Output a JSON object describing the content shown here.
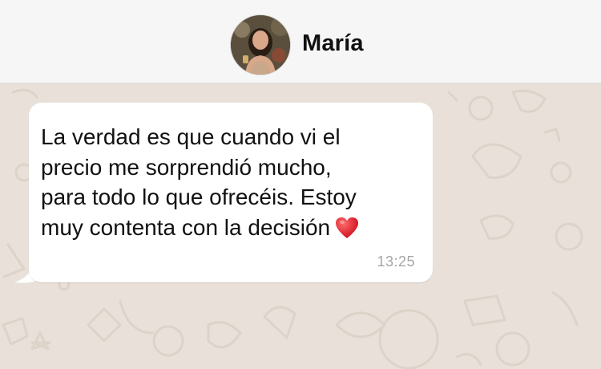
{
  "header": {
    "contact_name": "María",
    "avatar": "contact-photo"
  },
  "chat": {
    "wallpaper": "doodle-pattern",
    "messages": [
      {
        "text": "La verdad es que cuando vi el\nprecio me sorprendió mucho,\npara todo lo que ofrecéis. Estoy\nmuy contenta con la decisión",
        "emoji": "red-heart-icon",
        "time": "13:25",
        "direction": "incoming"
      }
    ]
  },
  "colors": {
    "header_bg": "#f6f6f6",
    "chat_bg": "#e9e1d9",
    "bubble_bg": "#ffffff",
    "text": "#111111",
    "timestamp": "#a5a5a5",
    "heart": "#e0202e"
  }
}
